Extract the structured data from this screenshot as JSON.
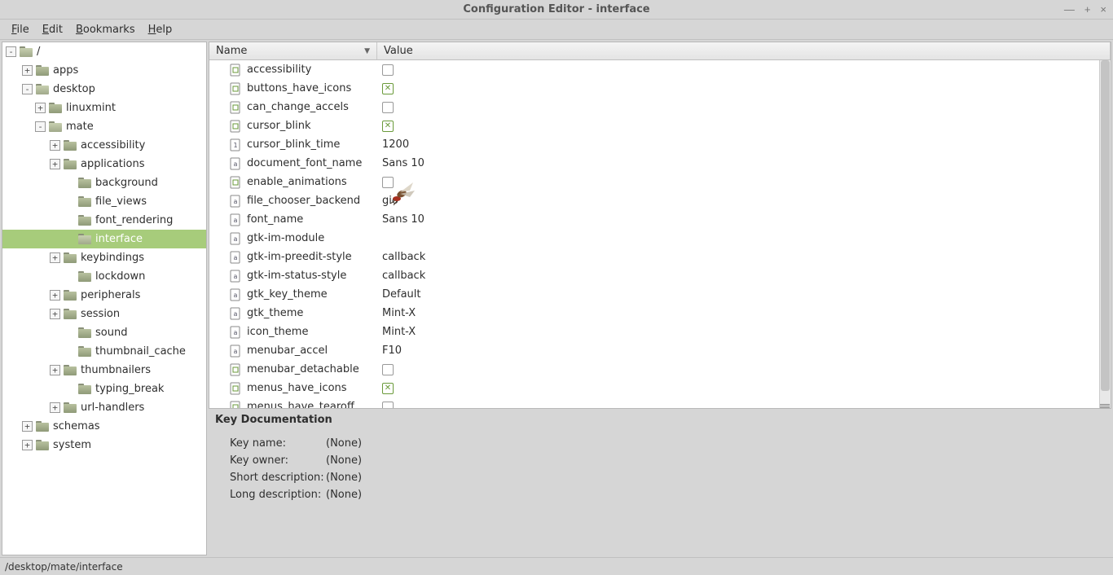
{
  "window": {
    "title": "Configuration Editor - interface"
  },
  "menubar": [
    {
      "label": "File",
      "u": "F"
    },
    {
      "label": "Edit",
      "u": "E"
    },
    {
      "label": "Bookmarks",
      "u": "B"
    },
    {
      "label": "Help",
      "u": "H"
    }
  ],
  "tree": [
    {
      "label": "/",
      "depth": 0,
      "exp": "-",
      "open": true
    },
    {
      "label": "apps",
      "depth": 1,
      "exp": "+"
    },
    {
      "label": "desktop",
      "depth": 1,
      "exp": "-",
      "open": true
    },
    {
      "label": "linuxmint",
      "depth": 2,
      "exp": "+"
    },
    {
      "label": "mate",
      "depth": 2,
      "exp": "-",
      "open": true
    },
    {
      "label": "accessibility",
      "depth": 3,
      "exp": "+"
    },
    {
      "label": "applications",
      "depth": 3,
      "exp": "+"
    },
    {
      "label": "background",
      "depth": 4,
      "exp": ""
    },
    {
      "label": "file_views",
      "depth": 4,
      "exp": ""
    },
    {
      "label": "font_rendering",
      "depth": 4,
      "exp": ""
    },
    {
      "label": "interface",
      "depth": 4,
      "exp": "",
      "selected": true,
      "open": true
    },
    {
      "label": "keybindings",
      "depth": 3,
      "exp": "+"
    },
    {
      "label": "lockdown",
      "depth": 4,
      "exp": ""
    },
    {
      "label": "peripherals",
      "depth": 3,
      "exp": "+"
    },
    {
      "label": "session",
      "depth": 3,
      "exp": "+"
    },
    {
      "label": "sound",
      "depth": 4,
      "exp": ""
    },
    {
      "label": "thumbnail_cache",
      "depth": 4,
      "exp": ""
    },
    {
      "label": "thumbnailers",
      "depth": 3,
      "exp": "+"
    },
    {
      "label": "typing_break",
      "depth": 4,
      "exp": ""
    },
    {
      "label": "url-handlers",
      "depth": 3,
      "exp": "+"
    },
    {
      "label": "schemas",
      "depth": 1,
      "exp": "+"
    },
    {
      "label": "system",
      "depth": 1,
      "exp": "+"
    }
  ],
  "list": {
    "columns": {
      "name": "Name",
      "value": "Value"
    },
    "rows": [
      {
        "name": "accessibility",
        "type": "bool",
        "bool": false
      },
      {
        "name": "buttons_have_icons",
        "type": "bool",
        "bool": true
      },
      {
        "name": "can_change_accels",
        "type": "bool",
        "bool": false
      },
      {
        "name": "cursor_blink",
        "type": "bool",
        "bool": true
      },
      {
        "name": "cursor_blink_time",
        "type": "int",
        "value": "1200"
      },
      {
        "name": "document_font_name",
        "type": "str",
        "value": "Sans 10"
      },
      {
        "name": "enable_animations",
        "type": "bool",
        "bool": false
      },
      {
        "name": "file_chooser_backend",
        "type": "str",
        "value": "gio"
      },
      {
        "name": "font_name",
        "type": "str",
        "value": "Sans 10"
      },
      {
        "name": "gtk-im-module",
        "type": "str",
        "value": ""
      },
      {
        "name": "gtk-im-preedit-style",
        "type": "str",
        "value": "callback"
      },
      {
        "name": "gtk-im-status-style",
        "type": "str",
        "value": "callback"
      },
      {
        "name": "gtk_key_theme",
        "type": "str",
        "value": "Default"
      },
      {
        "name": "gtk_theme",
        "type": "str",
        "value": "Mint-X"
      },
      {
        "name": "icon_theme",
        "type": "str",
        "value": "Mint-X"
      },
      {
        "name": "menubar_accel",
        "type": "str",
        "value": "F10"
      },
      {
        "name": "menubar_detachable",
        "type": "bool",
        "bool": false
      },
      {
        "name": "menus_have_icons",
        "type": "bool",
        "bool": true
      },
      {
        "name": "menus_have_tearoff",
        "type": "bool",
        "bool": false
      }
    ]
  },
  "doc": {
    "title": "Key Documentation",
    "key_name_label": "Key name:",
    "key_name_value": "(None)",
    "key_owner_label": "Key owner:",
    "key_owner_value": "(None)",
    "short_desc_label": "Short description:",
    "short_desc_value": "(None)",
    "long_desc_label": "Long description:",
    "long_desc_value": "(None)"
  },
  "statusbar": "/desktop/mate/interface"
}
